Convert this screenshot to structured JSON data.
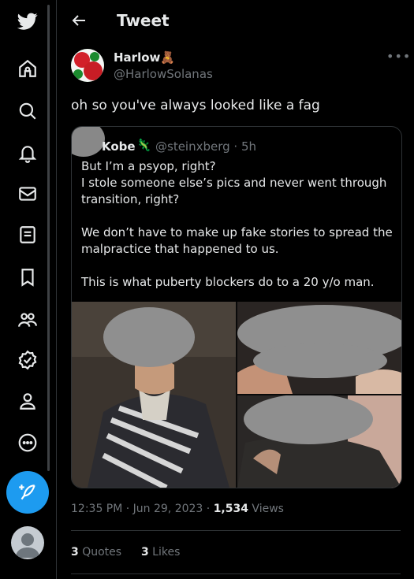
{
  "nav": {
    "items": [
      {
        "icon": "twitter-bird-icon"
      },
      {
        "icon": "home-icon"
      },
      {
        "icon": "search-icon"
      },
      {
        "icon": "bell-icon"
      },
      {
        "icon": "mail-icon"
      },
      {
        "icon": "lists-icon"
      },
      {
        "icon": "bookmark-icon"
      },
      {
        "icon": "communities-icon"
      },
      {
        "icon": "verified-icon"
      },
      {
        "icon": "profile-icon"
      },
      {
        "icon": "more-circle-icon"
      }
    ],
    "compose_icon": "feather-plus-icon"
  },
  "header": {
    "title": "Tweet"
  },
  "tweet": {
    "author_name": "Harlow",
    "author_emoji": "🧸",
    "author_handle": "@HarlowSolanas",
    "text": "oh so you've always looked like a fag",
    "timestamp": "12:35 PM · Jun 29, 2023 · ",
    "views_count": "1,534",
    "views_label": " Views",
    "quotes_count": "3",
    "quotes_label": " Quotes",
    "likes_count": "3",
    "likes_label": " Likes"
  },
  "quote": {
    "name": "Kobe",
    "emoji": "🦎",
    "handle": "@steinxberg · 5h",
    "lines": [
      "But I’m a psyop, right?",
      "I stole someone else’s pics and never went through transition, right?",
      "",
      "We don’t have to make up fake stories to spread the malpractice that happened to us.",
      "",
      "This is what puberty blockers do to a 20 y/o man."
    ]
  },
  "colors": {
    "accent": "#1d9bf0",
    "text": "#e7e9ea",
    "muted": "#71767b",
    "border": "#2f3336"
  }
}
